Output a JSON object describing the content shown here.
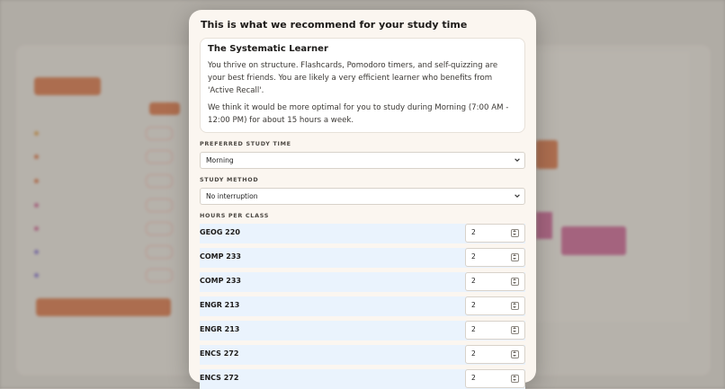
{
  "modal": {
    "title": "This is what we recommend for your study time",
    "card": {
      "title": "The Systematic Learner",
      "p1": "You thrive on structure. Flashcards, Pomodoro timers, and self-quizzing are your best friends. You are likely a very efficient learner who benefits from 'Active Recall'.",
      "p2": "We think it would be more optimal for you to study during Morning (7:00 AM - 12:00 PM) for about 15 hours a week."
    },
    "preferred_label": "PREFERRED STUDY TIME",
    "preferred_value": "Morning",
    "method_label": "STUDY METHOD",
    "method_value": "No interruption",
    "hours_label": "HOURS PER CLASS",
    "classes": [
      {
        "name": "GEOG 220",
        "hours": "2"
      },
      {
        "name": "COMP 233",
        "hours": "2"
      },
      {
        "name": "COMP 233",
        "hours": "2"
      },
      {
        "name": "ENGR 213",
        "hours": "2"
      },
      {
        "name": "ENGR 213",
        "hours": "2"
      },
      {
        "name": "ENCS 272",
        "hours": "2"
      },
      {
        "name": "ENCS 272",
        "hours": "2"
      }
    ]
  },
  "colors": {
    "accent": "#c36b42",
    "accent_pink": "#b85c86",
    "row_bg": "#eaf3fd",
    "modal_bg": "#fbf6f0"
  },
  "icons": {
    "select": "chevron-down-icon",
    "number": "spinner-icon"
  }
}
